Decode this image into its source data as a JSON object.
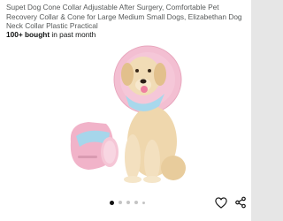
{
  "product": {
    "title": "Supet Dog Cone Collar Adjustable After Surgery, Comfortable Pet Recovery Collar & Cone for Large Medium Small Dogs, Elizabethan Dog Neck Collar Plastic Practical",
    "bought_count": "100+ bought",
    "bought_suffix": " in past month"
  },
  "gallery": {
    "slides": [
      "slide-1",
      "slide-2",
      "slide-3",
      "slide-4",
      "slide-5"
    ],
    "current_slide": 1
  },
  "actions": {
    "favorite_icon": "heart-icon",
    "share_icon": "share-icon"
  },
  "colors": {
    "cone_pink": "#f2b8cd",
    "cone_blue": "#9ed3e8",
    "dog_fur": "#f1dcb6",
    "text_primary": "#0f1111",
    "text_secondary": "#565959"
  }
}
